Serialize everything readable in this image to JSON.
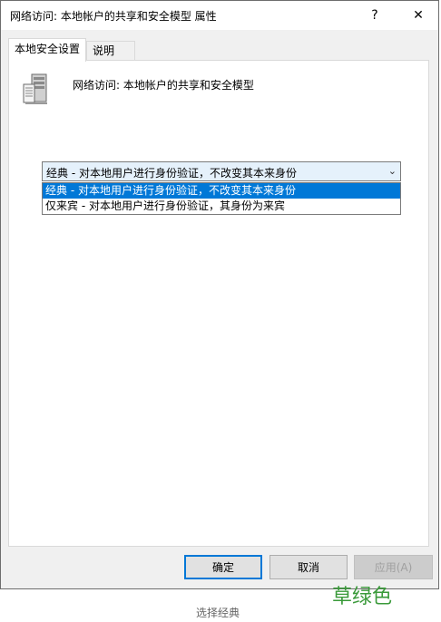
{
  "window": {
    "title": "网络访问: 本地帐户的共享和安全模型 属性",
    "help_glyph": "?",
    "close_glyph": "✕"
  },
  "tabs": [
    {
      "label": "本地安全设置",
      "active": true
    },
    {
      "label": "说明",
      "active": false
    }
  ],
  "policy": {
    "icon": "server-policy-icon",
    "title": "网络访问: 本地帐户的共享和安全模型"
  },
  "combo": {
    "selected": "经典 - 对本地用户进行身份验证，不改变其本来身份",
    "arrow_glyph": "⌄",
    "options": [
      "经典 - 对本地用户进行身份验证，不改变其本来身份",
      "仅来宾 - 对本地用户进行身份验证，其身份为来宾"
    ]
  },
  "buttons": {
    "ok": "确定",
    "cancel": "取消",
    "apply": "应用(A)"
  },
  "watermark": "草绿色",
  "caption": "选择经典",
  "colors": {
    "selection": "#0078d7",
    "dialog_bg": "#f0f0f0",
    "watermark": "#3a9a3a"
  }
}
